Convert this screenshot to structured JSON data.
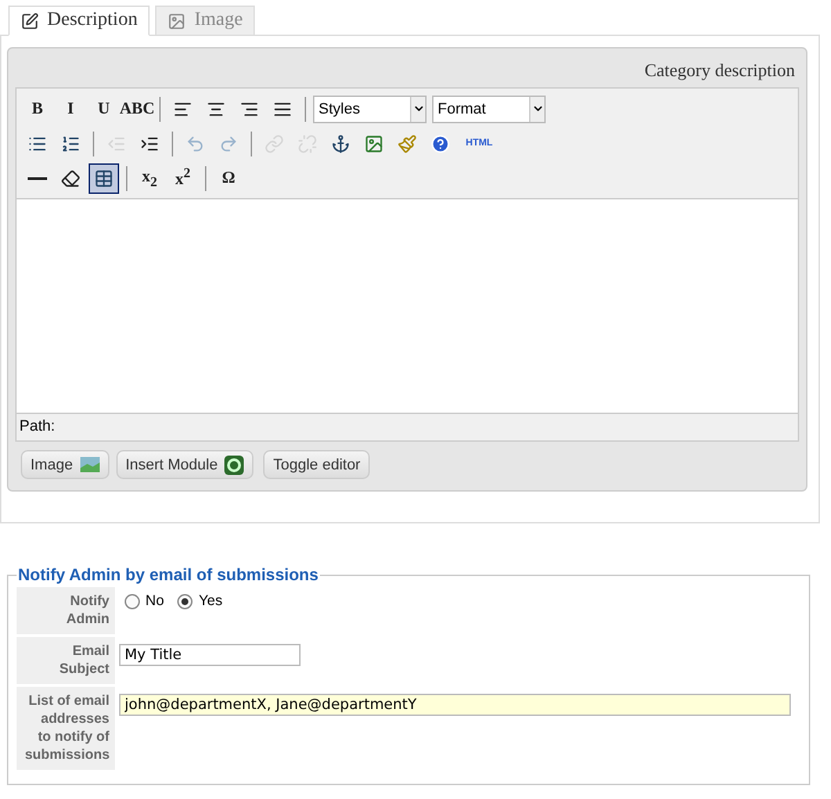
{
  "tabs": [
    {
      "label": "Description",
      "selected": true
    },
    {
      "label": "Image",
      "selected": false
    }
  ],
  "editor": {
    "title": "Category description",
    "toolbar": [
      [
        {
          "kind": "button",
          "label": "B",
          "disabled": false,
          "selected": false
        },
        {
          "kind": "button",
          "label": "I",
          "disabled": false,
          "selected": false
        },
        {
          "kind": "button",
          "label": "U",
          "disabled": false,
          "selected": false
        },
        {
          "kind": "button",
          "label": "ABC",
          "disabled": false,
          "selected": false
        },
        {
          "kind": "separator"
        },
        {
          "kind": "button",
          "disabled": false,
          "selected": false
        },
        {
          "kind": "button",
          "disabled": false,
          "selected": false
        },
        {
          "kind": "button",
          "disabled": false,
          "selected": false
        },
        {
          "kind": "button",
          "disabled": false,
          "selected": false
        },
        {
          "kind": "separator"
        },
        {
          "kind": "select",
          "label": "Styles"
        },
        {
          "kind": "select",
          "label": "Format"
        }
      ],
      [
        {
          "kind": "button",
          "disabled": false,
          "selected": false
        },
        {
          "kind": "button",
          "disabled": false,
          "selected": false
        },
        {
          "kind": "separator"
        },
        {
          "kind": "button",
          "disabled": true,
          "selected": false
        },
        {
          "kind": "button",
          "disabled": false,
          "selected": false
        },
        {
          "kind": "separator"
        },
        {
          "kind": "button",
          "disabled": true,
          "selected": false
        },
        {
          "kind": "button",
          "disabled": true,
          "selected": false
        },
        {
          "kind": "separator"
        },
        {
          "kind": "button",
          "disabled": true,
          "selected": false
        },
        {
          "kind": "button",
          "disabled": true,
          "selected": false
        },
        {
          "kind": "button",
          "disabled": false,
          "selected": false
        },
        {
          "kind": "button",
          "disabled": false,
          "selected": false
        },
        {
          "kind": "button",
          "disabled": false,
          "selected": false
        },
        {
          "kind": "button",
          "disabled": false,
          "selected": false
        },
        {
          "kind": "button",
          "label": "HTML",
          "disabled": false,
          "selected": false
        }
      ],
      [
        {
          "kind": "button",
          "disabled": false,
          "selected": false
        },
        {
          "kind": "button",
          "disabled": false,
          "selected": false
        },
        {
          "kind": "button",
          "disabled": false,
          "selected": true
        },
        {
          "kind": "separator"
        },
        {
          "kind": "button",
          "label": "x$_{2}$",
          "disabled": false,
          "selected": false
        },
        {
          "kind": "button",
          "label": "x$^{2}$",
          "disabled": false,
          "selected": false
        },
        {
          "kind": "separator"
        },
        {
          "kind": "button",
          "label": "Ω",
          "disabled": false,
          "selected": false
        }
      ]
    ],
    "path_label": "Path:",
    "buttons": [
      {
        "label": "Image"
      },
      {
        "label": "Insert Module"
      },
      {
        "label": "Toggle editor"
      }
    ]
  },
  "notify": {
    "legend": "Notify Admin by email of submissions",
    "fields": [
      {
        "kind": "radio",
        "label": "Notify Admin",
        "options": [
          {
            "label": "No",
            "selected": false
          },
          {
            "label": "Yes",
            "selected": true
          }
        ]
      },
      {
        "kind": "text",
        "label": "Email Subject",
        "value": "My Title"
      },
      {
        "kind": "wide",
        "label": "List of email addresses to notify of submissions",
        "value": "john@departmentX, Jane@departmentY"
      }
    ]
  }
}
